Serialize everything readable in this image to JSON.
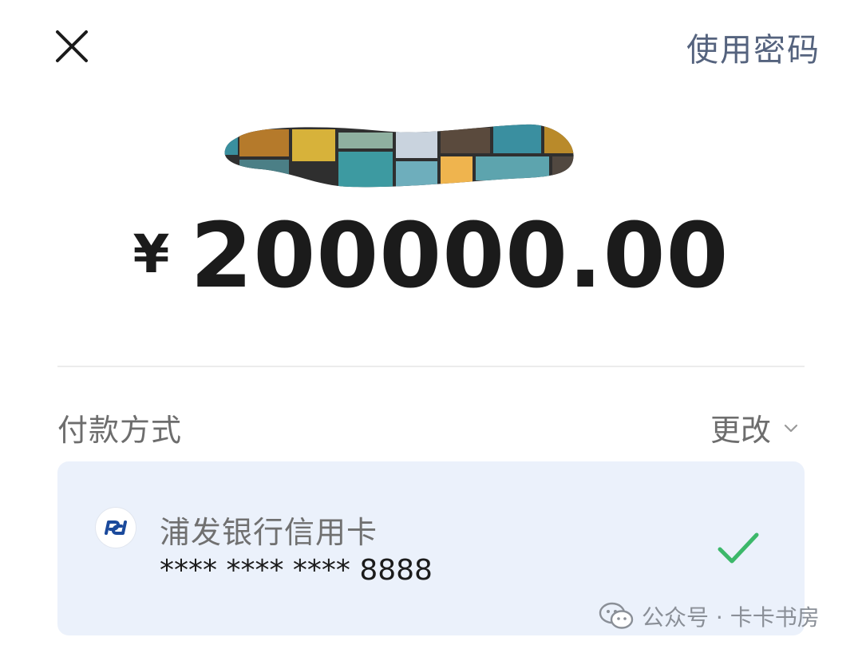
{
  "header": {
    "close_icon": "close-icon",
    "use_password_label": "使用密码",
    "accent_color": "#55637e"
  },
  "payee": {
    "redacted": true
  },
  "amount": {
    "currency_symbol": "¥",
    "value": "200000.00"
  },
  "payment_method": {
    "label": "付款方式",
    "change_label": "更改",
    "change_icon": "chevron-down-icon",
    "selected_card": {
      "bank_icon": "spdb-bank-logo-icon",
      "name": "浦发银行信用卡",
      "number": "**** **** **** 8888",
      "selected_icon": "check-icon",
      "check_color": "#3cb86a",
      "panel_color": "#ebf1fb"
    }
  },
  "watermark": {
    "icon": "wechat-icon",
    "text": "公众号 · 卡卡书房"
  }
}
